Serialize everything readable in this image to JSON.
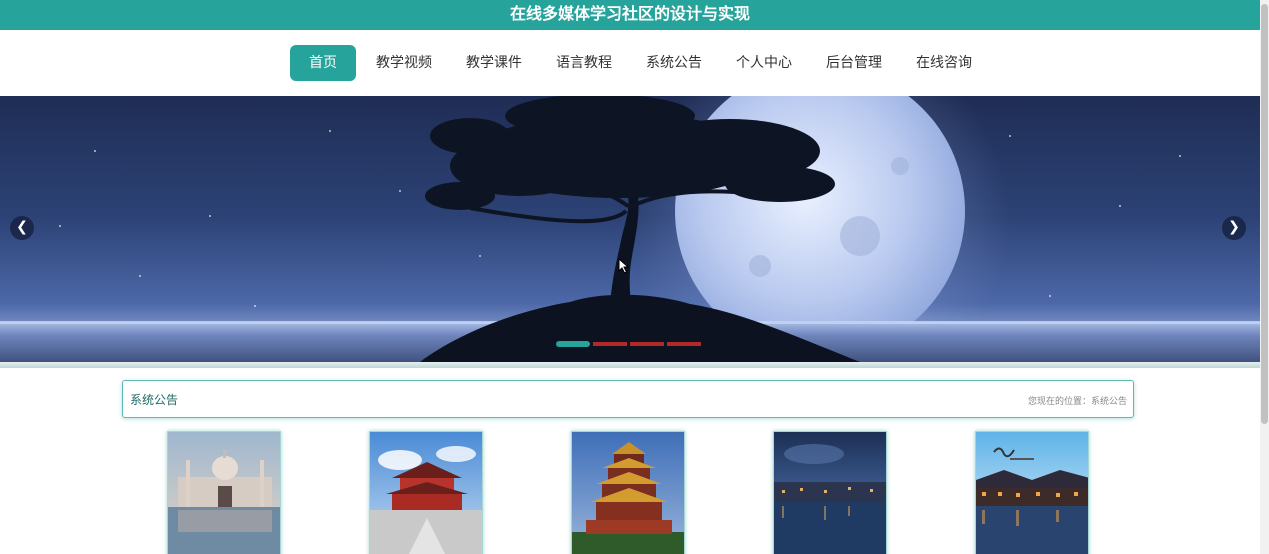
{
  "header": {
    "title": "在线多媒体学习社区的设计与实现"
  },
  "nav": {
    "items": [
      {
        "label": "首页",
        "active": true
      },
      {
        "label": "教学视频"
      },
      {
        "label": "教学课件"
      },
      {
        "label": "语言教程"
      },
      {
        "label": "系统公告"
      },
      {
        "label": "个人中心"
      },
      {
        "label": "后台管理"
      },
      {
        "label": "在线咨询"
      }
    ]
  },
  "banner": {
    "image": "night-moon-tree-scene",
    "prev_icon": "chevron-left-icon",
    "next_icon": "chevron-right-icon",
    "slide_count": 4,
    "active_slide": 1
  },
  "notice": {
    "title": "系统公告",
    "location": "您现在的位置：系统公告"
  },
  "cards": [
    {
      "image": "white-palace-reflection-photo"
    },
    {
      "image": "red-chinese-temple-photo"
    },
    {
      "image": "yellow-crane-pagoda-photo"
    },
    {
      "image": "water-town-dusk-photo"
    },
    {
      "image": "xitang-night-water-town-photo"
    }
  ],
  "colors": {
    "accent": "#26a39b",
    "dot_inactive": "#b02a2a"
  }
}
